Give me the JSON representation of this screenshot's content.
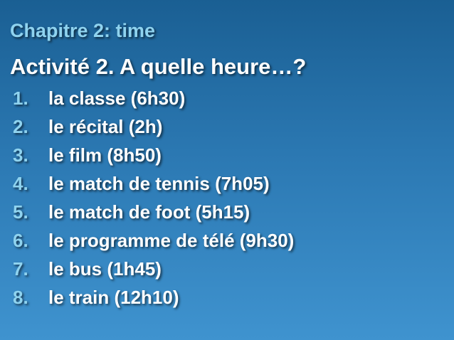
{
  "title": "Chapitre 2: time",
  "subtitle": "Activité 2.  A quelle heure…?",
  "items": [
    {
      "num": "1.",
      "text": "la classe (6h30)"
    },
    {
      "num": "2.",
      "text": "le récital (2h)"
    },
    {
      "num": "3.",
      "text": "le film (8h50)"
    },
    {
      "num": "4.",
      "text": "le match de tennis (7h05)"
    },
    {
      "num": "5.",
      "text": "le match de foot (5h15)"
    },
    {
      "num": "6.",
      "text": "le programme de télé (9h30)"
    },
    {
      "num": "7.",
      "text": "le bus (1h45)"
    },
    {
      "num": "8.",
      "text": "le train (12h10)"
    }
  ],
  "colors": {
    "accent": "#8fd3ef",
    "text": "#ffffff",
    "background_top": "#1a5f93",
    "background_bottom": "#3f93cf"
  }
}
